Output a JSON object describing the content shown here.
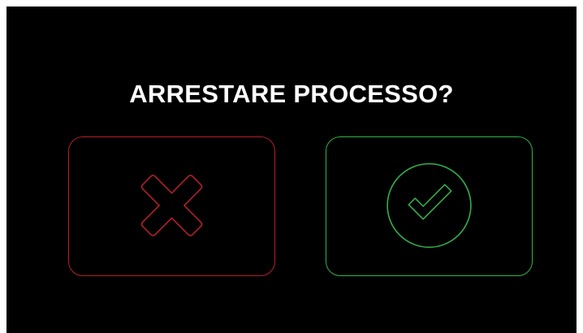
{
  "dialog": {
    "title": "ARRESTARE PROCESSO?"
  },
  "cancel_button": {
    "icon": "cross-icon",
    "color": "#b3202a"
  },
  "confirm_button": {
    "icon": "check-circle-icon",
    "color": "#33b04a"
  }
}
